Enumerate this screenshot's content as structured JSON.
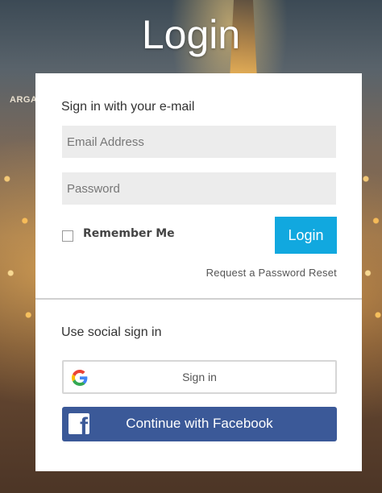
{
  "background": {
    "sign_text": "ARGA"
  },
  "header": {
    "title": "Login"
  },
  "form": {
    "email_heading": "Sign in with your e-mail",
    "email": {
      "value": "",
      "placeholder": "Email Address"
    },
    "password": {
      "value": "",
      "placeholder": "Password"
    },
    "remember_label": "Remember Me",
    "remember_checked": false,
    "login_label": "Login",
    "reset_label": "Request a Password Reset"
  },
  "social": {
    "heading": "Use social sign in",
    "google_label": "Sign in",
    "facebook_label": "Continue with Facebook"
  },
  "colors": {
    "accent": "#11a8df",
    "facebook": "#3b5998",
    "field_bg": "#ececec"
  },
  "icons": [
    "google-icon",
    "facebook-icon",
    "checkbox"
  ]
}
